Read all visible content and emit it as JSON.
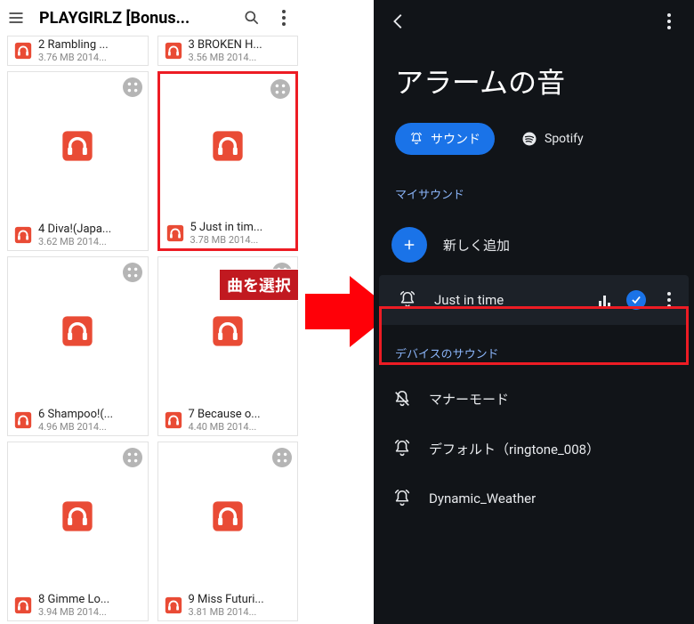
{
  "left": {
    "header_title": "PLAYGIRLZ [Bonus...",
    "tiles": [
      {
        "row": 0,
        "name": "2 Rambling ...",
        "info": "3.76 MB 2014..."
      },
      {
        "row": 0,
        "name": "3 BROKEN H...",
        "info": "3.56 MB 2014..."
      },
      {
        "row": 1,
        "name": "4 Diva!(Japa...",
        "info": "3.62 MB 2014..."
      },
      {
        "row": 1,
        "name": "5 Just in tim...",
        "info": "3.78 MB 2014...",
        "selected": true
      },
      {
        "row": 2,
        "name": "6 Shampoo!(...",
        "info": "4.96 MB 2014..."
      },
      {
        "row": 2,
        "name": "7 Because o...",
        "info": "4.40 MB 2014..."
      },
      {
        "row": 3,
        "name": "8 Gimme Lo...",
        "info": "3.94 MB 2014..."
      },
      {
        "row": 3,
        "name": "9 Miss Futuri...",
        "info": "3.81 MB 2014..."
      }
    ],
    "annotation": "曲を選択"
  },
  "right": {
    "title": "アラームの音",
    "chip_sound": "サウンド",
    "chip_spotify": "Spotify",
    "section_my_sounds": "マイサウンド",
    "add_new": "新しく追加",
    "selected_sound": "Just in time",
    "section_device_sounds": "デバイスのサウンド",
    "device_rows": [
      "マナーモード",
      "デフォルト（ringtone_008）",
      "Dynamic_Weather"
    ]
  },
  "icons": {
    "hamburger": "menu",
    "search": "search",
    "kebab": "more-vert",
    "back": "arrow-back",
    "headphones": "headphones",
    "expand": "fullscreen",
    "bell": "alarm-bell",
    "bell_off": "bell-slash",
    "plus": "plus",
    "check": "check",
    "spotify": "spotify"
  },
  "colors": {
    "accent_red": "#ed1c24",
    "accent_blue": "#1a73e8",
    "dark_bg": "#111418",
    "label_blue": "#8ab4f8"
  }
}
